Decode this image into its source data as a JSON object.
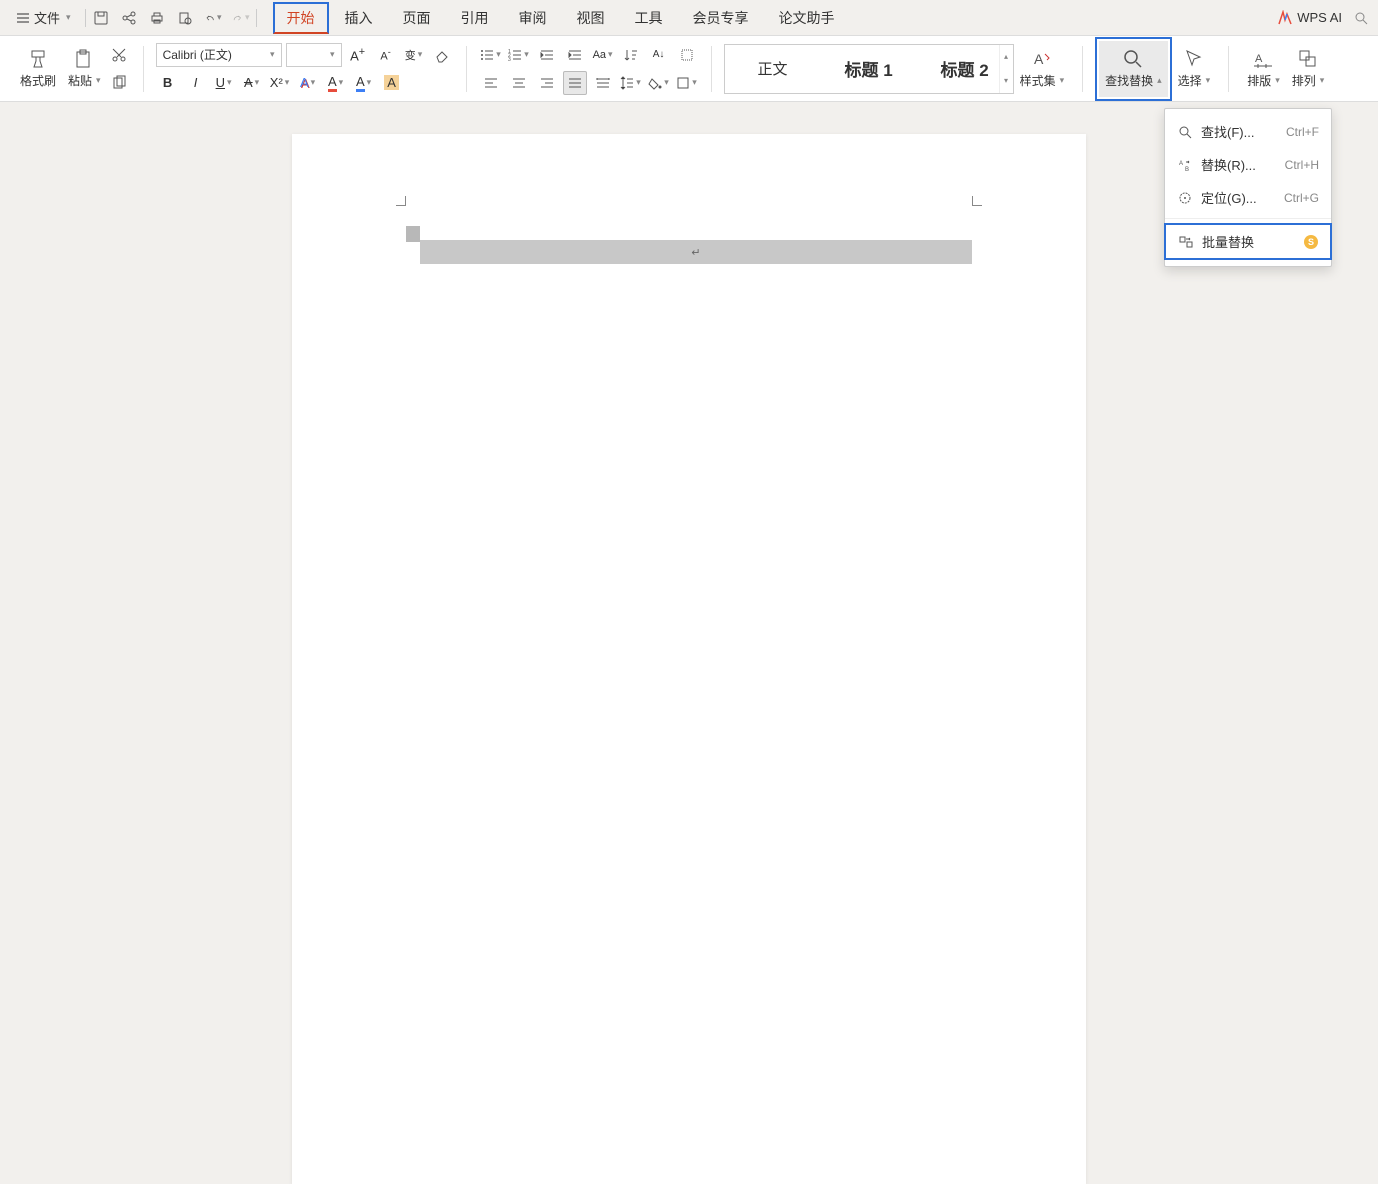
{
  "menubar": {
    "file_label": "文件",
    "tabs": [
      "开始",
      "插入",
      "页面",
      "引用",
      "审阅",
      "视图",
      "工具",
      "会员专享",
      "论文助手"
    ],
    "active_tab": "开始",
    "ai_label": "WPS AI"
  },
  "ribbon": {
    "format_painter": "格式刷",
    "paste": "粘贴",
    "font_name": "Calibri (正文)",
    "font_size": "",
    "style_gallery": {
      "normal": "正文",
      "heading1": "标题 1",
      "heading2": "标题 2"
    },
    "style_set": "样式集",
    "find_replace": "查找替换",
    "select": "选择",
    "layout": "排版",
    "arrange": "排列"
  },
  "dropdown": {
    "find": {
      "label": "查找(F)...",
      "shortcut": "Ctrl+F"
    },
    "replace": {
      "label": "替换(R)...",
      "shortcut": "Ctrl+H"
    },
    "goto": {
      "label": "定位(G)...",
      "shortcut": "Ctrl+G"
    },
    "batch_replace": {
      "label": "批量替换"
    }
  }
}
